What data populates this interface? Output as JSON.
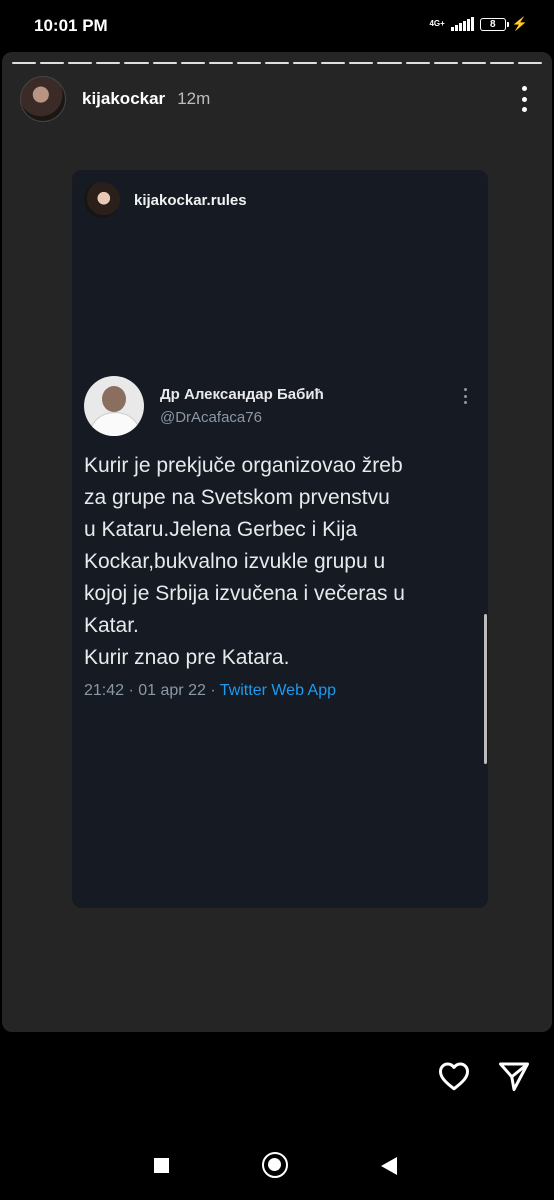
{
  "status_bar": {
    "time": "10:01 PM",
    "network": "4G+",
    "battery": "8"
  },
  "story": {
    "username": "kijakockar",
    "time_ago": "12m",
    "progress_segments": 19
  },
  "card": {
    "username": "kijakockar.rules",
    "tweet": {
      "author_name": "Др Александар Бабић",
      "author_handle": "@DrAcafaca76",
      "text": "Kurir je prekjuče organizovao žreb\nza grupe na Svetskom prvenstvu\nu Kataru.Jelena Gerbec i Kija\nKockar,bukvalno izvukle grupu u\nkojoj je Srbija izvučena i večeras u\nKatar.\nKurir znao pre Katara.",
      "timestamp": "21:42 · 01 apr 22 · ",
      "source": "Twitter Web App"
    }
  },
  "actions": {
    "like_icon": "heart-icon",
    "share_icon": "send-icon"
  },
  "navigation": {
    "recents": "square",
    "home": "circle",
    "back": "triangle"
  }
}
